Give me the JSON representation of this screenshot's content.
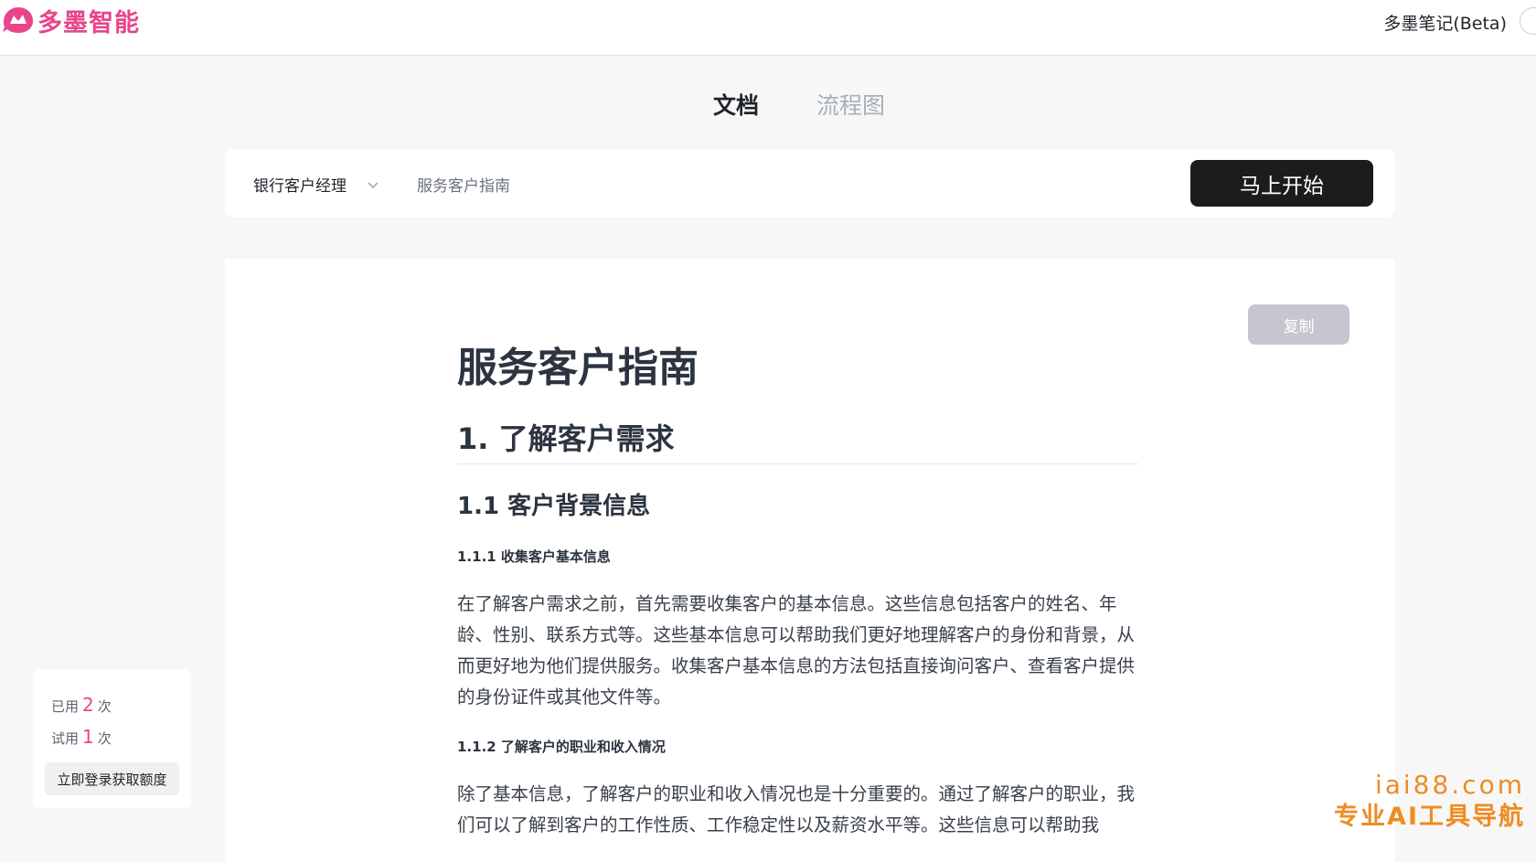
{
  "header": {
    "logo_text": "多墨智能",
    "notes_link": "多墨笔记(Beta)",
    "brand_color": "#e8458b"
  },
  "tabs": [
    {
      "label": "文档",
      "active": true
    },
    {
      "label": "流程图",
      "active": false
    }
  ],
  "input_bar": {
    "role_value": "银行客户经理",
    "topic_value": "服务客户指南",
    "start_label": "马上开始"
  },
  "document": {
    "copy_label": "复制",
    "title": "服务客户指南",
    "h2": "1. 了解客户需求",
    "h3": "1.1 客户背景信息",
    "h4_1": "1.1.1 收集客户基本信息",
    "p1": "在了解客户需求之前，首先需要收集客户的基本信息。这些信息包括客户的姓名、年龄、性别、联系方式等。这些基本信息可以帮助我们更好地理解客户的身份和背景，从而更好地为他们提供服务。收集客户基本信息的方法包括直接询问客户、查看客户提供的身份证件或其他文件等。",
    "h4_2": "1.1.2 了解客户的职业和收入情况",
    "p2": "除了基本信息，了解客户的职业和收入情况也是十分重要的。通过了解客户的职业，我们可以了解到客户的工作性质、工作稳定性以及薪资水平等。这些信息可以帮助我"
  },
  "quota": {
    "used_prefix": "已用",
    "used_count": "2",
    "used_suffix": "次",
    "trial_prefix": "试用",
    "trial_count": "1",
    "trial_suffix": "次",
    "login_label": "立即登录获取额度"
  },
  "watermark": {
    "url": "iai88.com",
    "title": "专业AI工具导航",
    "color": "#ee8c23"
  }
}
